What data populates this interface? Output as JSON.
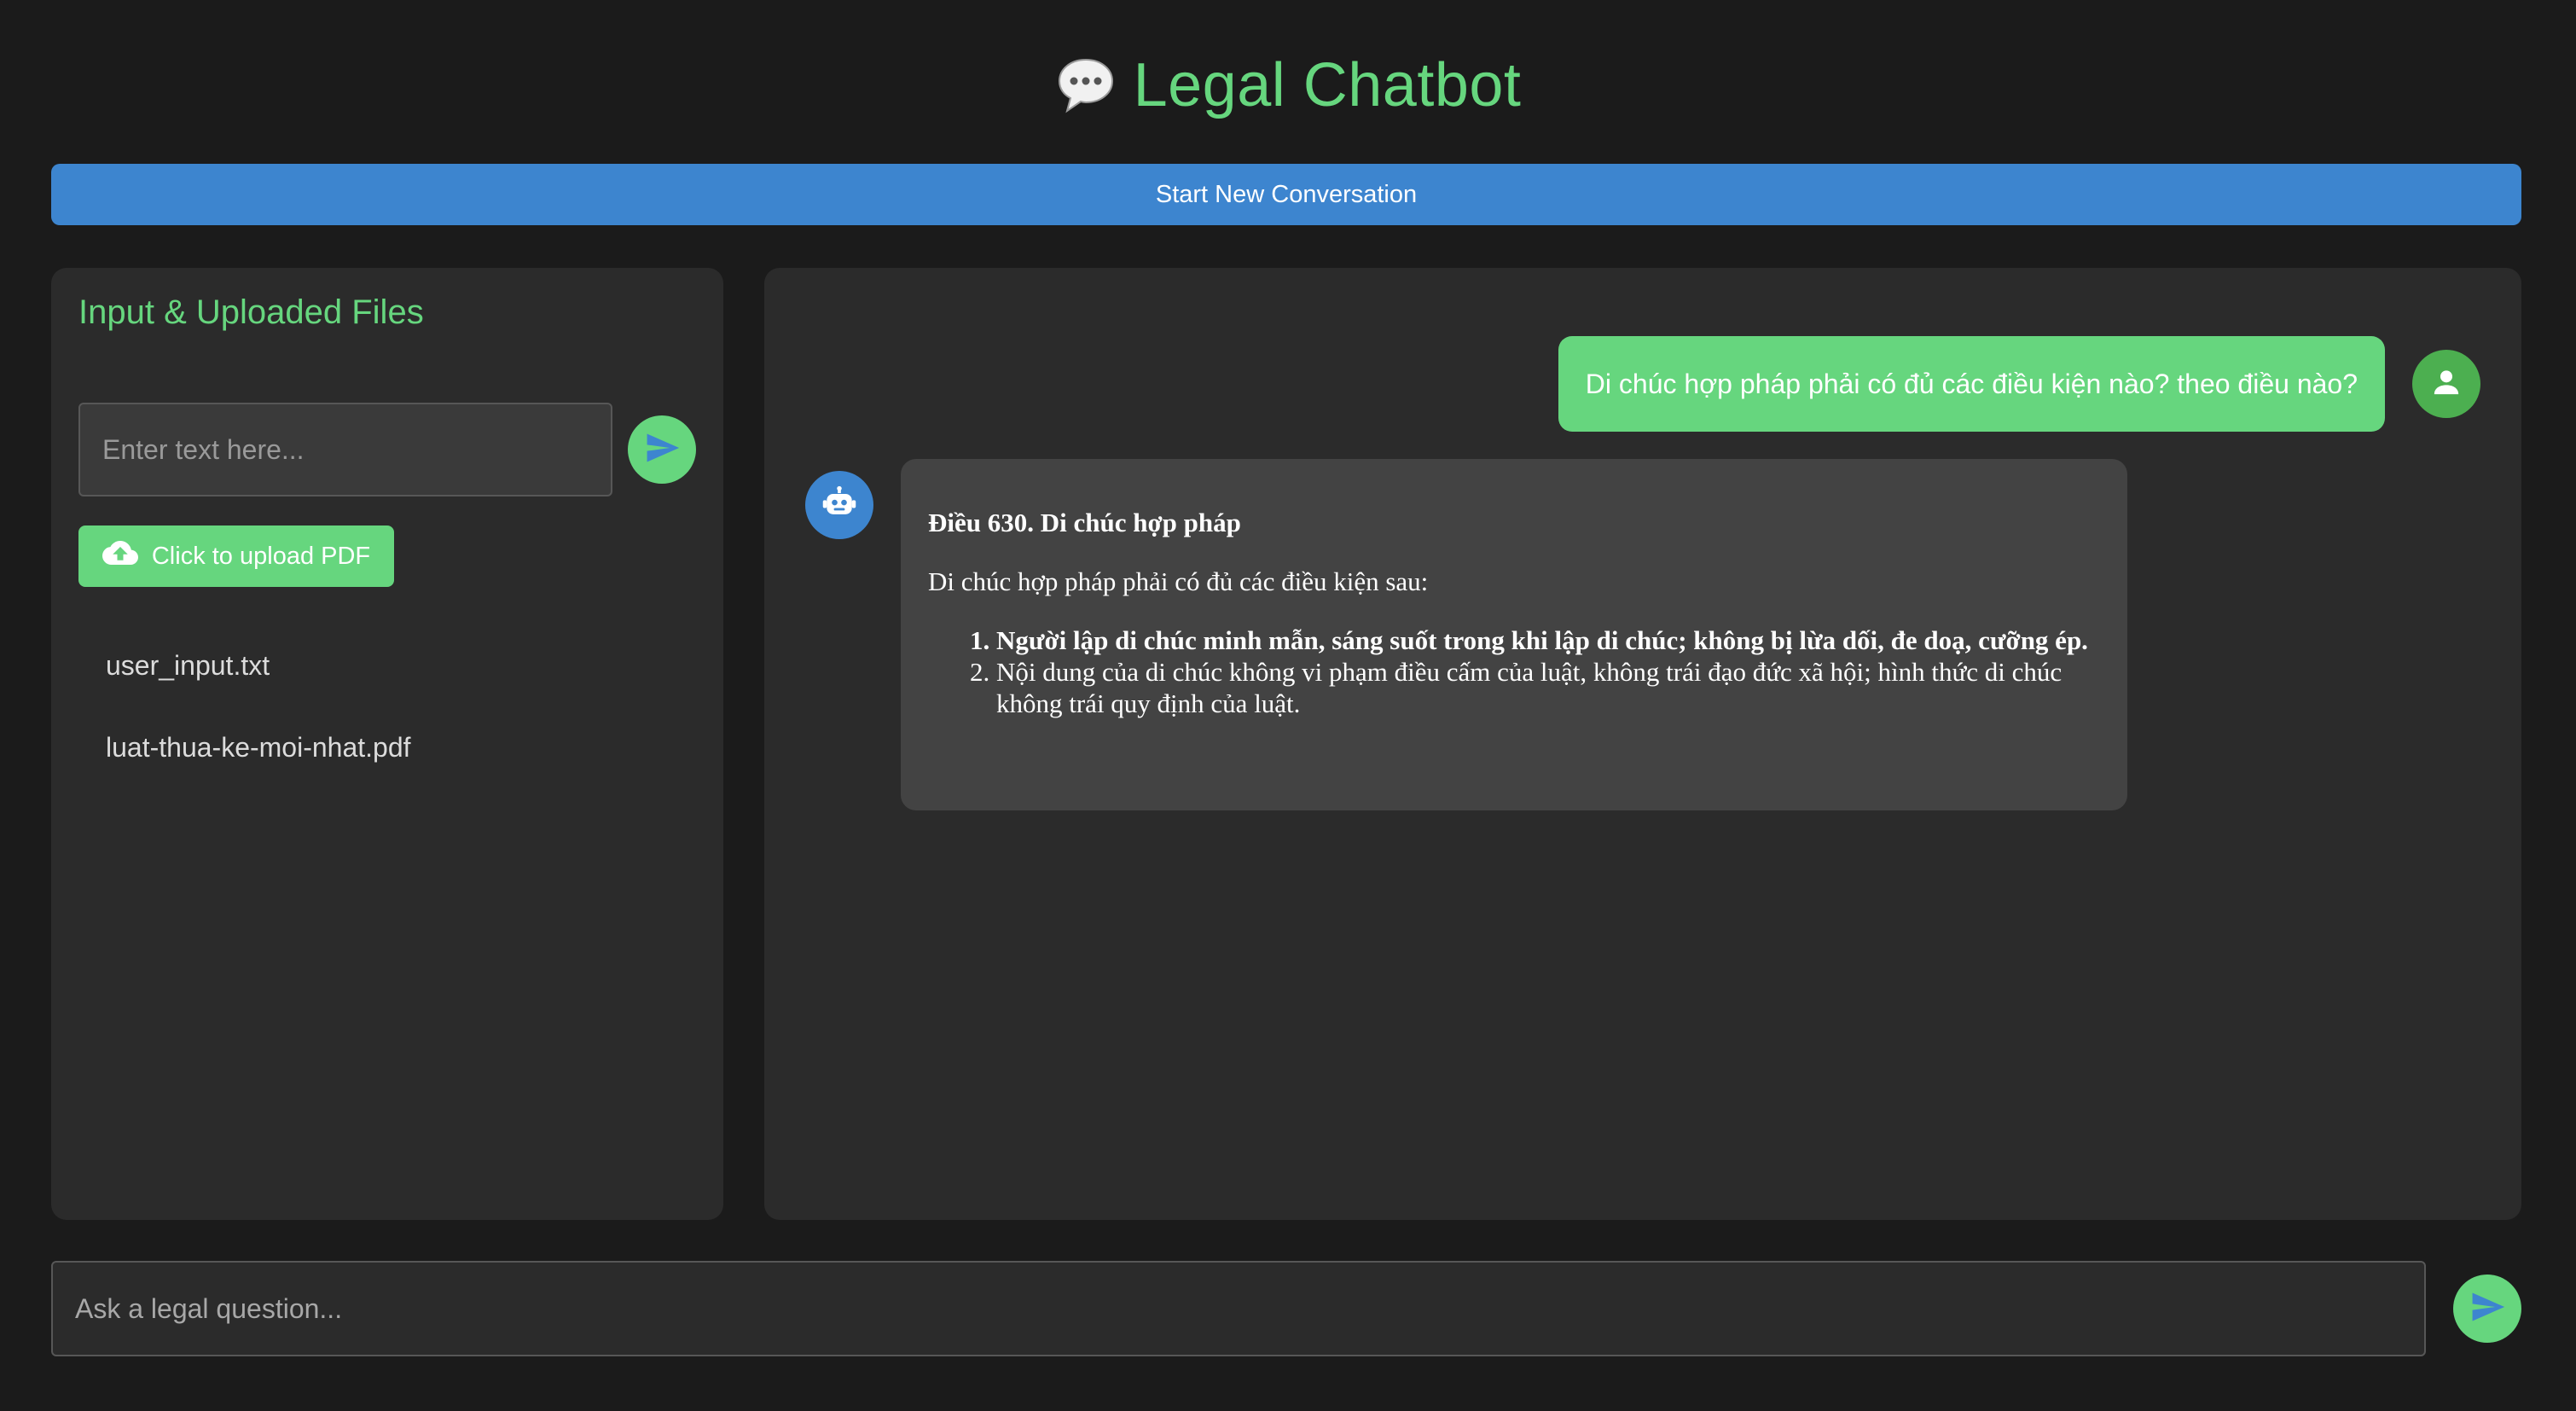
{
  "app": {
    "title": "Legal Chatbot",
    "title_icon": "speech-bubble-icon",
    "accent_color": "#66d67e",
    "primary_color": "#3d85cf"
  },
  "toolbar": {
    "new_conversation_label": "Start New Conversation"
  },
  "left_panel": {
    "title": "Input & Uploaded Files",
    "text_input_placeholder": "Enter text here...",
    "upload_button_label": "Click to upload PDF",
    "files": [
      "user_input.txt",
      "luat-thua-ke-moi-nhat.pdf"
    ]
  },
  "chat": {
    "messages": [
      {
        "role": "user",
        "text": "Di chúc hợp pháp phải có đủ các điều kiện nào? theo điều nào?"
      },
      {
        "role": "bot",
        "title": "Điều 630. Di chúc hợp pháp",
        "intro": "Di chúc hợp pháp phải có đủ các điều kiện sau:",
        "conditions": [
          "Người lập di chúc minh mẫn, sáng suốt trong khi lập di chúc; không bị lừa dối, đe doạ, cưỡng ép.",
          "Nội dung của di chúc không vi phạm điều cấm của luật, không trái đạo đức xã hội; hình thức di chúc không trái quy định của luật."
        ]
      }
    ]
  },
  "question_input": {
    "placeholder": "Ask a legal question..."
  }
}
